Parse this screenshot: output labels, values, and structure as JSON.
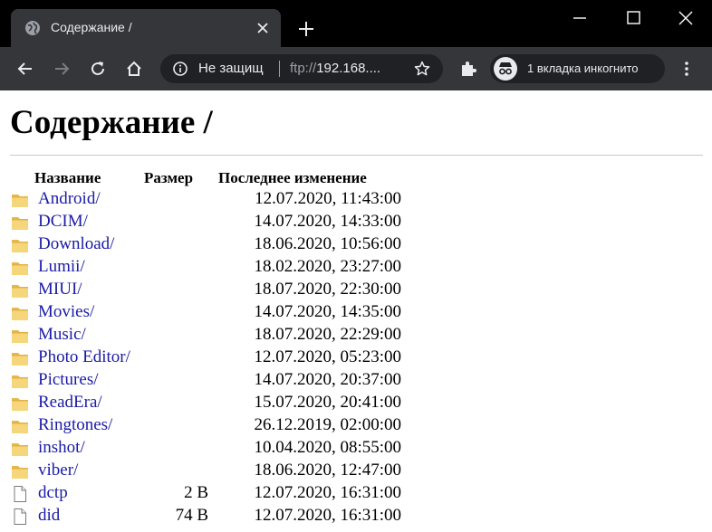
{
  "browser": {
    "tab_title": "Содержание /",
    "new_tab_icon": "plus-icon",
    "omnibox": {
      "security_label": "Не защищ",
      "url_scheme": "ftp://",
      "url_rest": "192.168...."
    },
    "incognito_label": "1 вкладка инкогнито",
    "colors": {
      "titlebar": "#000000",
      "toolbar": "#35363a",
      "omnibox": "#202124",
      "link": "#1a1aa6"
    }
  },
  "page": {
    "title": "Содержание /",
    "columns": {
      "name": "Название",
      "size": "Размер",
      "modified": "Последнее изменение"
    },
    "rows": [
      {
        "type": "folder",
        "name": "Android/",
        "size": "",
        "modified": "12.07.2020, 11:43:00"
      },
      {
        "type": "folder",
        "name": "DCIM/",
        "size": "",
        "modified": "14.07.2020, 14:33:00"
      },
      {
        "type": "folder",
        "name": "Download/",
        "size": "",
        "modified": "18.06.2020, 10:56:00"
      },
      {
        "type": "folder",
        "name": "Lumii/",
        "size": "",
        "modified": "18.02.2020, 23:27:00"
      },
      {
        "type": "folder",
        "name": "MIUI/",
        "size": "",
        "modified": "18.07.2020, 22:30:00"
      },
      {
        "type": "folder",
        "name": "Movies/",
        "size": "",
        "modified": "14.07.2020, 14:35:00"
      },
      {
        "type": "folder",
        "name": "Music/",
        "size": "",
        "modified": "18.07.2020, 22:29:00"
      },
      {
        "type": "folder",
        "name": "Photo Editor/",
        "size": "",
        "modified": "12.07.2020, 05:23:00"
      },
      {
        "type": "folder",
        "name": "Pictures/",
        "size": "",
        "modified": "14.07.2020, 20:37:00"
      },
      {
        "type": "folder",
        "name": "ReadEra/",
        "size": "",
        "modified": "15.07.2020, 20:41:00"
      },
      {
        "type": "folder",
        "name": "Ringtones/",
        "size": "",
        "modified": "26.12.2019, 02:00:00"
      },
      {
        "type": "folder",
        "name": "inshot/",
        "size": "",
        "modified": "10.04.2020, 08:55:00"
      },
      {
        "type": "folder",
        "name": "viber/",
        "size": "",
        "modified": "18.06.2020, 12:47:00"
      },
      {
        "type": "file",
        "name": "dctp",
        "size": "2 B",
        "modified": "12.07.2020, 16:31:00"
      },
      {
        "type": "file",
        "name": "did",
        "size": "74 B",
        "modified": "12.07.2020, 16:31:00"
      }
    ]
  }
}
